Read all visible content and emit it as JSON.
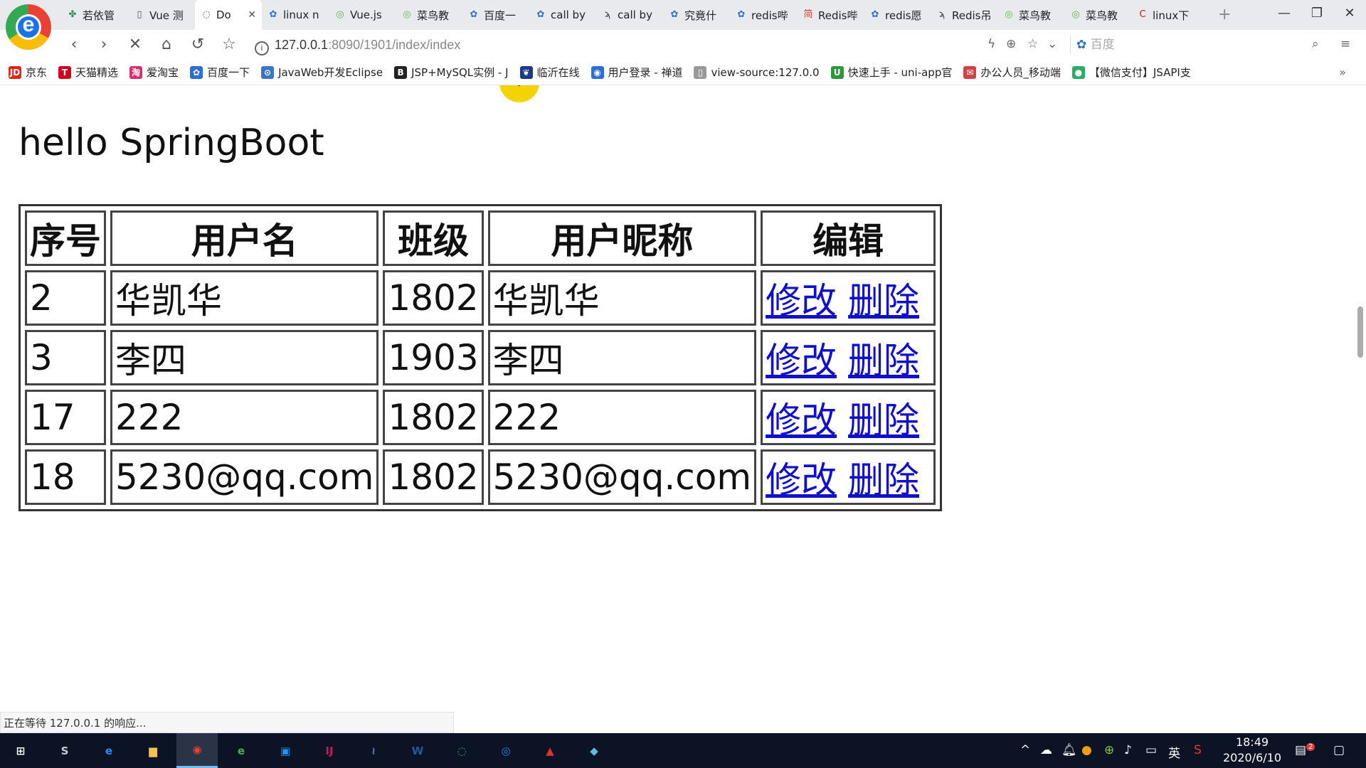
{
  "browser": {
    "logo_letter": "e",
    "tabs": [
      {
        "title": "若依管",
        "icon": "leaf-icon",
        "color": "#2e8b57"
      },
      {
        "title": "Vue 测",
        "icon": "page-icon",
        "color": "#555555"
      },
      {
        "title": "Do",
        "icon": "loading-icon",
        "color": "#555555",
        "active": true
      },
      {
        "title": "linux n",
        "icon": "paw-icon",
        "color": "#2b6fd6"
      },
      {
        "title": "Vue.js",
        "icon": "runoob-icon",
        "color": "#5fb34a"
      },
      {
        "title": "菜鸟教",
        "icon": "runoob-icon",
        "color": "#5fb34a"
      },
      {
        "title": "百度一",
        "icon": "paw-icon",
        "color": "#2b6fd6"
      },
      {
        "title": "call by",
        "icon": "paw-icon",
        "color": "#2b6fd6"
      },
      {
        "title": "call by",
        "icon": "bird-icon",
        "color": "#333333"
      },
      {
        "title": "究竟什",
        "icon": "paw-icon",
        "color": "#2b6fd6"
      },
      {
        "title": "redis哔",
        "icon": "paw-icon",
        "color": "#2b6fd6"
      },
      {
        "title": "Redis哔",
        "icon": "jianshu-icon",
        "color": "#e0413a"
      },
      {
        "title": "redis愿",
        "icon": "paw-icon",
        "color": "#2b6fd6"
      },
      {
        "title": "Redis吊",
        "icon": "bird-icon",
        "color": "#333333"
      },
      {
        "title": "菜鸟教",
        "icon": "runoob-icon",
        "color": "#5fb34a"
      },
      {
        "title": "菜鸟教",
        "icon": "runoob-icon",
        "color": "#5fb34a"
      },
      {
        "title": "linux下",
        "icon": "csdn-icon",
        "color": "#c9171e"
      }
    ],
    "tab_close_glyph": "✕",
    "new_tab_glyph": "+",
    "address": {
      "host": "127.0.0.1",
      "path": ":8090/1901/index/index"
    },
    "search_placeholder": "百度",
    "status_text": "正在等待 127.0.0.1 的响应...",
    "bookmarks": [
      {
        "label": "京东",
        "icon": "jd-icon",
        "color": "#e1251b",
        "glyph": "JD"
      },
      {
        "label": "天猫精选",
        "icon": "tmall-icon",
        "color": "#d0021b",
        "glyph": "T"
      },
      {
        "label": "爱淘宝",
        "icon": "taobao-icon",
        "color": "#d62f6b",
        "glyph": "淘"
      },
      {
        "label": "百度一下",
        "icon": "paw-icon",
        "color": "#2b6fd6",
        "glyph": "✿"
      },
      {
        "label": "JavaWeb开发Eclipse",
        "icon": "eclipse-icon",
        "color": "#3a76c4",
        "glyph": "⊙"
      },
      {
        "label": "JSP+MySQL实例 - J",
        "icon": "bilibili-icon",
        "color": "#222222",
        "glyph": "B"
      },
      {
        "label": "临沂在线",
        "icon": "tulip-icon",
        "color": "#1a3a8a",
        "glyph": "❦"
      },
      {
        "label": "用户登录 - 禅道",
        "icon": "globe-icon",
        "color": "#2b6fd6",
        "glyph": "◉"
      },
      {
        "label": "view-source:127.0.0",
        "icon": "page-icon",
        "color": "#999999",
        "glyph": "▯"
      },
      {
        "label": "快速上手 - uni-app官",
        "icon": "uniapp-icon",
        "color": "#2b9939",
        "glyph": "U"
      },
      {
        "label": "办公人员_移动端",
        "icon": "mail-icon",
        "color": "#c44",
        "glyph": "✉"
      },
      {
        "label": "【微信支付】JSAPI支",
        "icon": "wechat-icon",
        "color": "#2aae67",
        "glyph": "●"
      }
    ],
    "bookmark_more": "»"
  },
  "page": {
    "heading": "hello SpringBoot",
    "table": {
      "headers": [
        "序号",
        "用户名",
        "班级",
        "用户昵称",
        "编辑"
      ],
      "rows": [
        {
          "id": "2",
          "username": "华凯华",
          "class": "1802",
          "nickname": "华凯华"
        },
        {
          "id": "3",
          "username": "李四",
          "class": "1903",
          "nickname": "李四"
        },
        {
          "id": "17",
          "username": "222",
          "class": "1802",
          "nickname": "222"
        },
        {
          "id": "18",
          "username": "5230@qq.com",
          "class": "1802",
          "nickname": "5230@qq.com"
        }
      ],
      "edit_label": "修改",
      "delete_label": "删除"
    }
  },
  "taskbar": {
    "apps": [
      {
        "name": "start-button",
        "glyph": "⊞",
        "color": "#ffffff"
      },
      {
        "name": "hub-icon",
        "glyph": "S",
        "color": "#c8cbd2"
      },
      {
        "name": "ie-icon",
        "glyph": "e",
        "color": "#1e90ff"
      },
      {
        "name": "file-explorer-icon",
        "glyph": "▆",
        "color": "#f2c14e"
      },
      {
        "name": "chrome-icon",
        "glyph": "◉",
        "color": "#e94235",
        "active": true
      },
      {
        "name": "360-browser-icon",
        "glyph": "e",
        "color": "#4caf50"
      },
      {
        "name": "vm-icon",
        "glyph": "▣",
        "color": "#2196f3"
      },
      {
        "name": "intellij-icon",
        "glyph": "IJ",
        "color": "#c21a5f"
      },
      {
        "name": "dolphin-icon",
        "glyph": "≀",
        "color": "#6b7fd7"
      },
      {
        "name": "word-icon",
        "glyph": "W",
        "color": "#2b579a"
      },
      {
        "name": "wechat-icon",
        "glyph": "◌",
        "color": "#2aae67"
      },
      {
        "name": "globe-app-icon",
        "glyph": "◎",
        "color": "#1e88e5"
      },
      {
        "name": "navicat-icon",
        "glyph": "▲",
        "color": "#d33"
      },
      {
        "name": "notepad-icon",
        "glyph": "◆",
        "color": "#5bc0de"
      }
    ],
    "tray": {
      "ime": "英",
      "time": "18:49",
      "date": "2020/6/10",
      "notification_count": "2"
    }
  }
}
